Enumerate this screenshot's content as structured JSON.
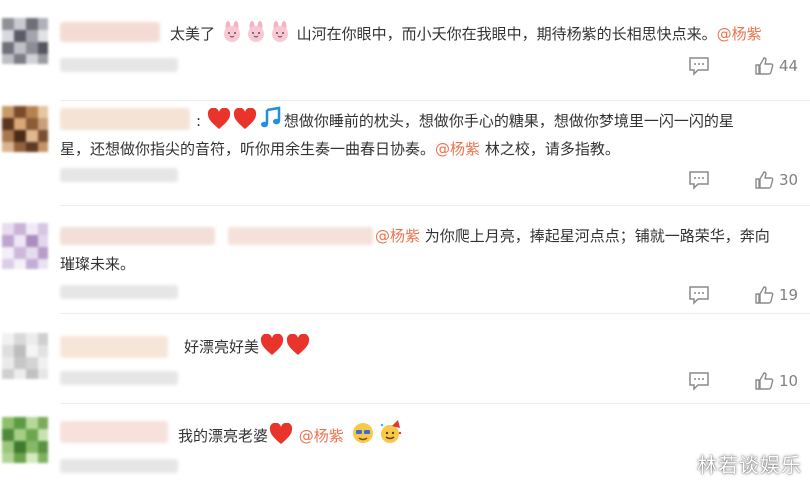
{
  "colors": {
    "mention": "#eb7350",
    "text": "#333333",
    "muted": "#808080"
  },
  "comments": [
    {
      "text_a": "太美了",
      "text_b": "山河在你眼中，而小夭你在我眼中，期待杨紫的长相思快点来。",
      "mention": "@杨紫",
      "emojis": [
        "bunny-emoji",
        "bunny-emoji",
        "bunny-emoji"
      ],
      "likes": "44"
    },
    {
      "prefix": ":",
      "line1": "想做你睡前的枕头，想做你手心的糖果，想做你梦境里一闪一闪的星",
      "line2_a": "星，还想做你指尖的音符，听你用余生奏一曲春日协奏。",
      "mention": "@杨紫",
      "line2_b": "林之校，请多指教。",
      "emojis": [
        "heart-emoji",
        "heart-emoji",
        "music-note-emoji"
      ],
      "likes": "30"
    },
    {
      "mention": "@杨紫",
      "line1": "为你爬上月亮，捧起星河点点；铺就一路荣华，奔向",
      "line2": "璀璨未来。",
      "likes": "19"
    },
    {
      "text": "好漂亮好美",
      "emojis": [
        "heart-emoji",
        "heart-emoji"
      ],
      "likes": "10"
    },
    {
      "text": "我的漂亮老婆",
      "mention": "@杨紫",
      "emojis": [
        "heart-emoji",
        "face-emoji",
        "party-face-emoji"
      ]
    }
  ],
  "watermark": "林若谈娱乐"
}
